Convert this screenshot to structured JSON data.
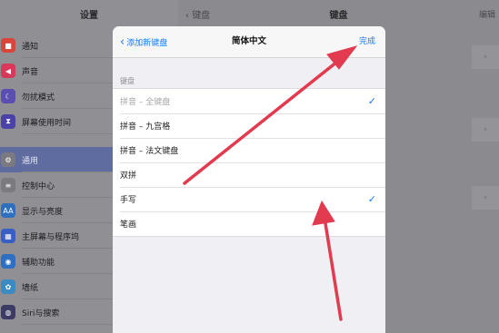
{
  "sidebar": {
    "title": "设置",
    "items": [
      {
        "label": "通知",
        "icon": "bell-icon",
        "color": "#d9443b",
        "glyph": "■"
      },
      {
        "label": "声音",
        "icon": "speaker-icon",
        "color": "#d43a5a",
        "glyph": "◀"
      },
      {
        "label": "勿扰模式",
        "icon": "moon-icon",
        "color": "#5a4fb0",
        "glyph": "☾"
      },
      {
        "label": "屏幕使用时间",
        "icon": "hourglass-icon",
        "color": "#4a42a6",
        "glyph": "⧗"
      },
      {
        "label": "通用",
        "icon": "gear-icon",
        "color": "#7a7a80",
        "glyph": "⚙"
      },
      {
        "label": "控制中心",
        "icon": "toggles-icon",
        "color": "#7a7a80",
        "glyph": "≡"
      },
      {
        "label": "显示与亮度",
        "icon": "text-size-icon",
        "color": "#2f6fc0",
        "glyph": "AA"
      },
      {
        "label": "主屏幕与程序坞",
        "icon": "grid-icon",
        "color": "#3a5fc4",
        "glyph": "▦"
      },
      {
        "label": "辅助功能",
        "icon": "accessibility-icon",
        "color": "#2f6fc0",
        "glyph": "◉"
      },
      {
        "label": "墙纸",
        "icon": "flower-icon",
        "color": "#3a8bc4",
        "glyph": "✿"
      },
      {
        "label": "Siri与搜索",
        "icon": "siri-icon",
        "color": "#3b3b66",
        "glyph": "◍"
      }
    ]
  },
  "detail": {
    "back": "键盘",
    "title": "键盘",
    "edit": "编辑"
  },
  "sheet": {
    "back_label": "添加新键盘",
    "title": "简体中文",
    "done_label": "完成",
    "section_header": "键盘",
    "keyboards": [
      {
        "label": "拼音 – 全键盘",
        "checked": true,
        "disabled": true
      },
      {
        "label": "拼音 – 九宫格",
        "checked": false,
        "disabled": false
      },
      {
        "label": "拼音 – 法文键盘",
        "checked": false,
        "disabled": false
      },
      {
        "label": "双拼",
        "checked": false,
        "disabled": false
      },
      {
        "label": "手写",
        "checked": true,
        "disabled": false
      },
      {
        "label": "笔画",
        "checked": false,
        "disabled": false
      }
    ]
  },
  "colors": {
    "accent": "#1478f5",
    "arrow": "#e23a4e"
  }
}
